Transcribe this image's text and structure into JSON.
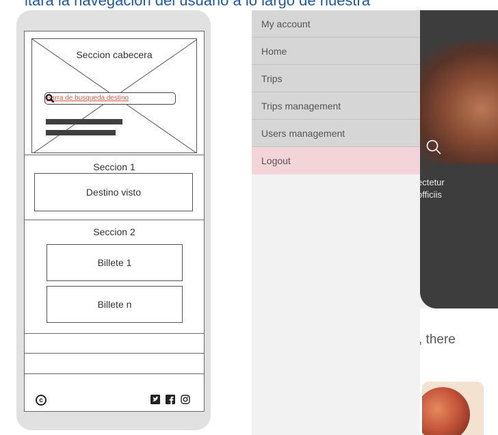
{
  "top_caption": "itará la navegación del usuario a lo largo de nuestra",
  "wireframe": {
    "header_title": "Seccion cabecera",
    "search_placeholder": "Barra de busqueda destino",
    "section1_title": "Seccion 1",
    "section1_box": "Destino visto",
    "section2_title": "Seccion 2",
    "ticket_first": "Billete 1",
    "ticket_last": "Billete n",
    "footer_copyright_symbol": "c",
    "footer_icons": [
      "twitter-icon",
      "facebook-icon",
      "instagram-icon"
    ]
  },
  "app": {
    "menu": [
      {
        "label": "My account"
      },
      {
        "label": "Home"
      },
      {
        "label": "Trips"
      },
      {
        "label": "Trips management"
      },
      {
        "label": "Users management"
      },
      {
        "label": "Logout"
      }
    ],
    "hero_text_line1": "ectetur",
    "hero_text_line2": "officiis",
    "intro_fragment": ", there",
    "colors": {
      "menu_bg": "#d6d6d6",
      "logout_bg": "#f3d4d9",
      "dark_panel": "#3d3d3d",
      "search_text": "#e05b4c"
    }
  }
}
